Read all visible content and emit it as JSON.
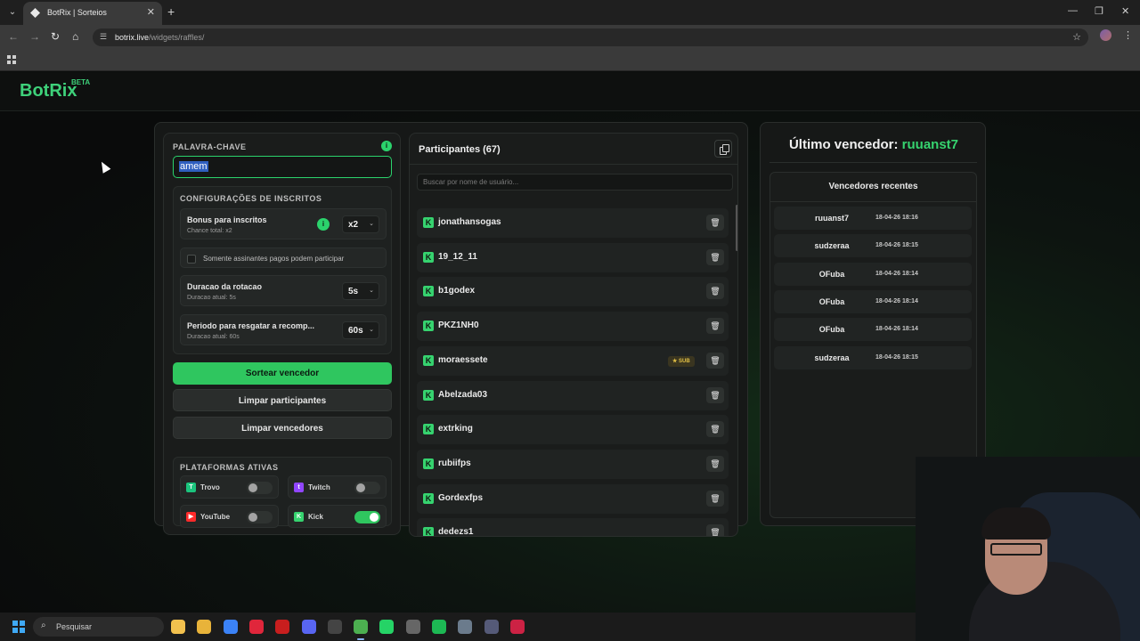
{
  "browser": {
    "tab_title": "BotRix | Sorteios",
    "url_host": "botrix.live",
    "url_path": "/widgets/raffles/",
    "tab_close": "✕",
    "new_tab": "+",
    "back": "←",
    "forward": "→",
    "reload": "↻",
    "home": "⌂",
    "minimize": "—",
    "maximize": "❐",
    "close": "✕",
    "star": "☆",
    "menu": "⋮",
    "tab_list": "⌄",
    "site_info": "☰"
  },
  "brand": {
    "logo": "BotRix",
    "badge": "BETA"
  },
  "keyword": {
    "label": "PALAVRA-CHAVE",
    "value": "amem",
    "info": "i"
  },
  "subscribers_config": {
    "title": "CONFIGURAÇÕES DE INSCRITOS",
    "bonus_title": "Bonus para inscritos",
    "bonus_sub": "Chance total: x2",
    "bonus_value": "x2",
    "paid_only_label": "Somente assinantes pagos podem participar",
    "rotation_title": "Duracao da rotacao",
    "rotation_sub": "Duracao atual: 5s",
    "rotation_value": "5s",
    "claim_title": "Periodo para resgatar a recomp...",
    "claim_sub": "Duracao atual: 60s",
    "claim_value": "60s",
    "chevron": "⌄"
  },
  "actions": {
    "draw": "Sortear vencedor",
    "clear_participants": "Limpar participantes",
    "clear_winners": "Limpar vencedores"
  },
  "platforms": {
    "title": "PLATAFORMAS ATIVAS",
    "items": [
      {
        "name": "Trovo",
        "icon": "trovo-icon",
        "glyph": "T",
        "color": "#1bc47d",
        "enabled": false
      },
      {
        "name": "Twitch",
        "icon": "twitch-icon",
        "glyph": "t",
        "color": "#9146ff",
        "enabled": false
      },
      {
        "name": "YouTube",
        "icon": "youtube-icon",
        "glyph": "▶",
        "color": "#ff2a2a",
        "enabled": false
      },
      {
        "name": "Kick",
        "icon": "kick-icon",
        "glyph": "K",
        "color": "#36d36f",
        "enabled": true
      }
    ]
  },
  "participants": {
    "title": "Participantes (67)",
    "search_placeholder": "Buscar por nome de usuário...",
    "kick_glyph": "K",
    "trash_glyph": "🗑",
    "sub_badge": "★ SUB",
    "list": [
      {
        "name": "jonathansogas",
        "sub": false
      },
      {
        "name": "19_12_11",
        "sub": false
      },
      {
        "name": "b1godex",
        "sub": false
      },
      {
        "name": "PKZ1NH0",
        "sub": false
      },
      {
        "name": "moraessete",
        "sub": true
      },
      {
        "name": "Abelzada03",
        "sub": false
      },
      {
        "name": "extrking",
        "sub": false
      },
      {
        "name": "rubiifps",
        "sub": false
      },
      {
        "name": "Gordexfps",
        "sub": false
      },
      {
        "name": "dedezs1",
        "sub": false
      }
    ]
  },
  "winners": {
    "last_label": "Último vencedor:",
    "last_name": "ruuanst7",
    "recent_title": "Vencedores recentes",
    "list": [
      {
        "name": "ruuanst7",
        "date": "18-04-26 18:16"
      },
      {
        "name": "sudzeraa",
        "date": "18-04-26 18:15"
      },
      {
        "name": "OFuba",
        "date": "18-04-26 18:14"
      },
      {
        "name": "OFuba",
        "date": "18-04-26 18:14"
      },
      {
        "name": "OFuba",
        "date": "18-04-26 18:14"
      },
      {
        "name": "sudzeraa",
        "date": "18-04-26 18:15"
      }
    ]
  },
  "taskbar": {
    "search_label": "Pesquisar",
    "search_glyph": "⌕",
    "apps": [
      {
        "name": "file-explorer-icon",
        "color": "#f2c14e"
      },
      {
        "name": "folder-icon",
        "color": "#e8b33a"
      },
      {
        "name": "store-icon",
        "color": "#3b82f6"
      },
      {
        "name": "opera-icon",
        "color": "#e0263b"
      },
      {
        "name": "app-red-icon",
        "color": "#c81e1e"
      },
      {
        "name": "discord-icon",
        "color": "#5865f2"
      },
      {
        "name": "xbox-icon",
        "color": "#444444"
      },
      {
        "name": "chrome-icon",
        "color": "#4caf50"
      },
      {
        "name": "whatsapp-icon",
        "color": "#25d366"
      },
      {
        "name": "app-gray-icon",
        "color": "#666666"
      },
      {
        "name": "spotify-icon",
        "color": "#1db954"
      },
      {
        "name": "settings-icon",
        "color": "#6b7b8c"
      },
      {
        "name": "audio-icon",
        "color": "#555a78"
      },
      {
        "name": "adobe-icon",
        "color": "#cc2244"
      }
    ]
  }
}
